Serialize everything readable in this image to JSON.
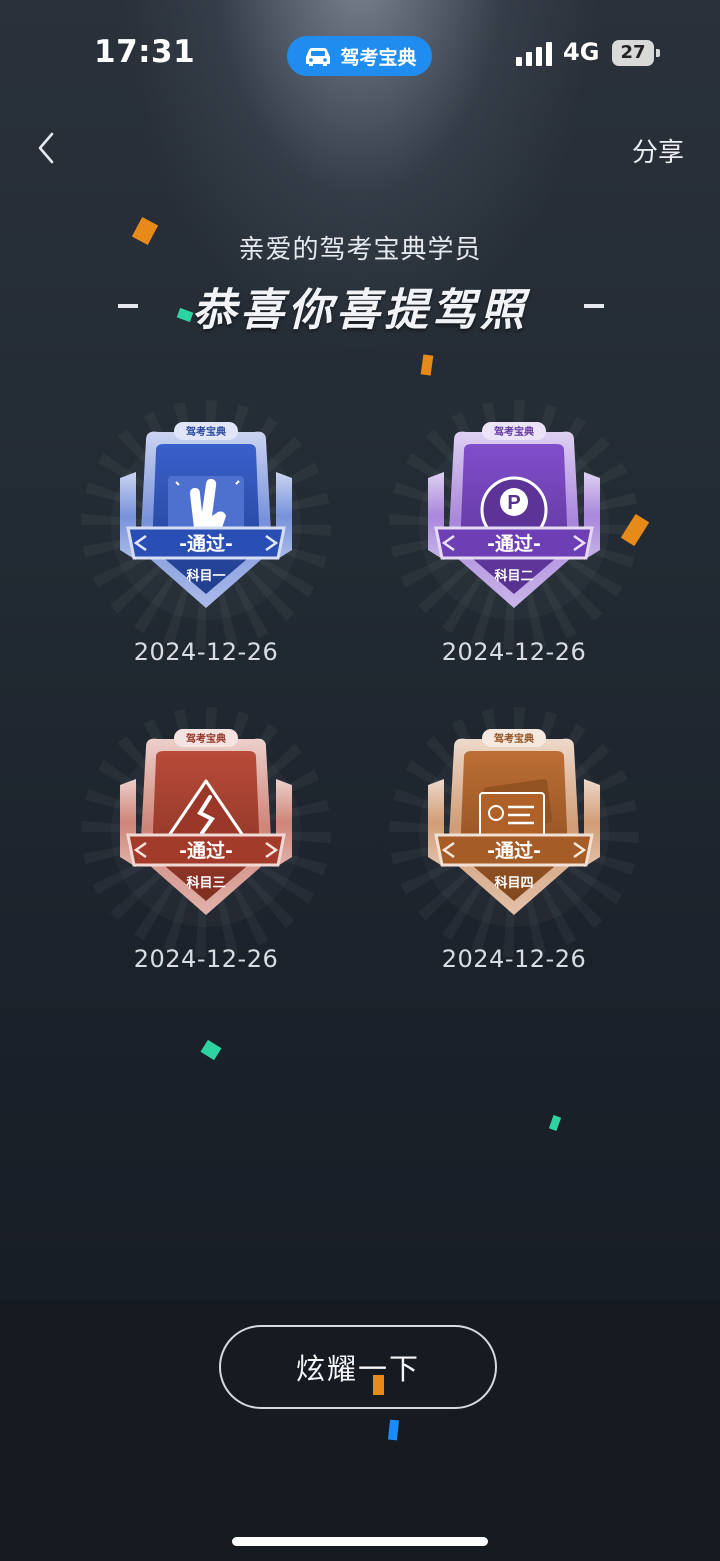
{
  "status_bar": {
    "time": "17:31",
    "app_name": "驾考宝典",
    "network": "4G",
    "battery": "27"
  },
  "nav": {
    "share_label": "分享"
  },
  "header": {
    "greeting": "亲爱的驾考宝典学员",
    "title": "恭喜你喜提驾照"
  },
  "badges": [
    {
      "brand": "驾考宝典",
      "status": "-通过-",
      "subject": "科目一",
      "date": "2024-12-26",
      "icon": "victory-hand-icon",
      "color": "#2f58c8"
    },
    {
      "brand": "驾考宝典",
      "status": "-通过-",
      "subject": "科目二",
      "date": "2024-12-26",
      "icon": "parking-p-icon",
      "color": "#7a45c9"
    },
    {
      "brand": "驾考宝典",
      "status": "-通过-",
      "subject": "科目三",
      "date": "2024-12-26",
      "icon": "road-sign-icon",
      "color": "#b5412f"
    },
    {
      "brand": "驾考宝典",
      "status": "-通过-",
      "subject": "科目四",
      "date": "2024-12-26",
      "icon": "license-card-icon",
      "color": "#b8662a"
    }
  ],
  "cta": {
    "label": "炫耀一下"
  },
  "colors": {
    "accent": "#1f8cf0",
    "confetti_orange": "#e88a1a",
    "confetti_green": "#2dd4a0",
    "confetti_blue": "#1a8cff"
  }
}
